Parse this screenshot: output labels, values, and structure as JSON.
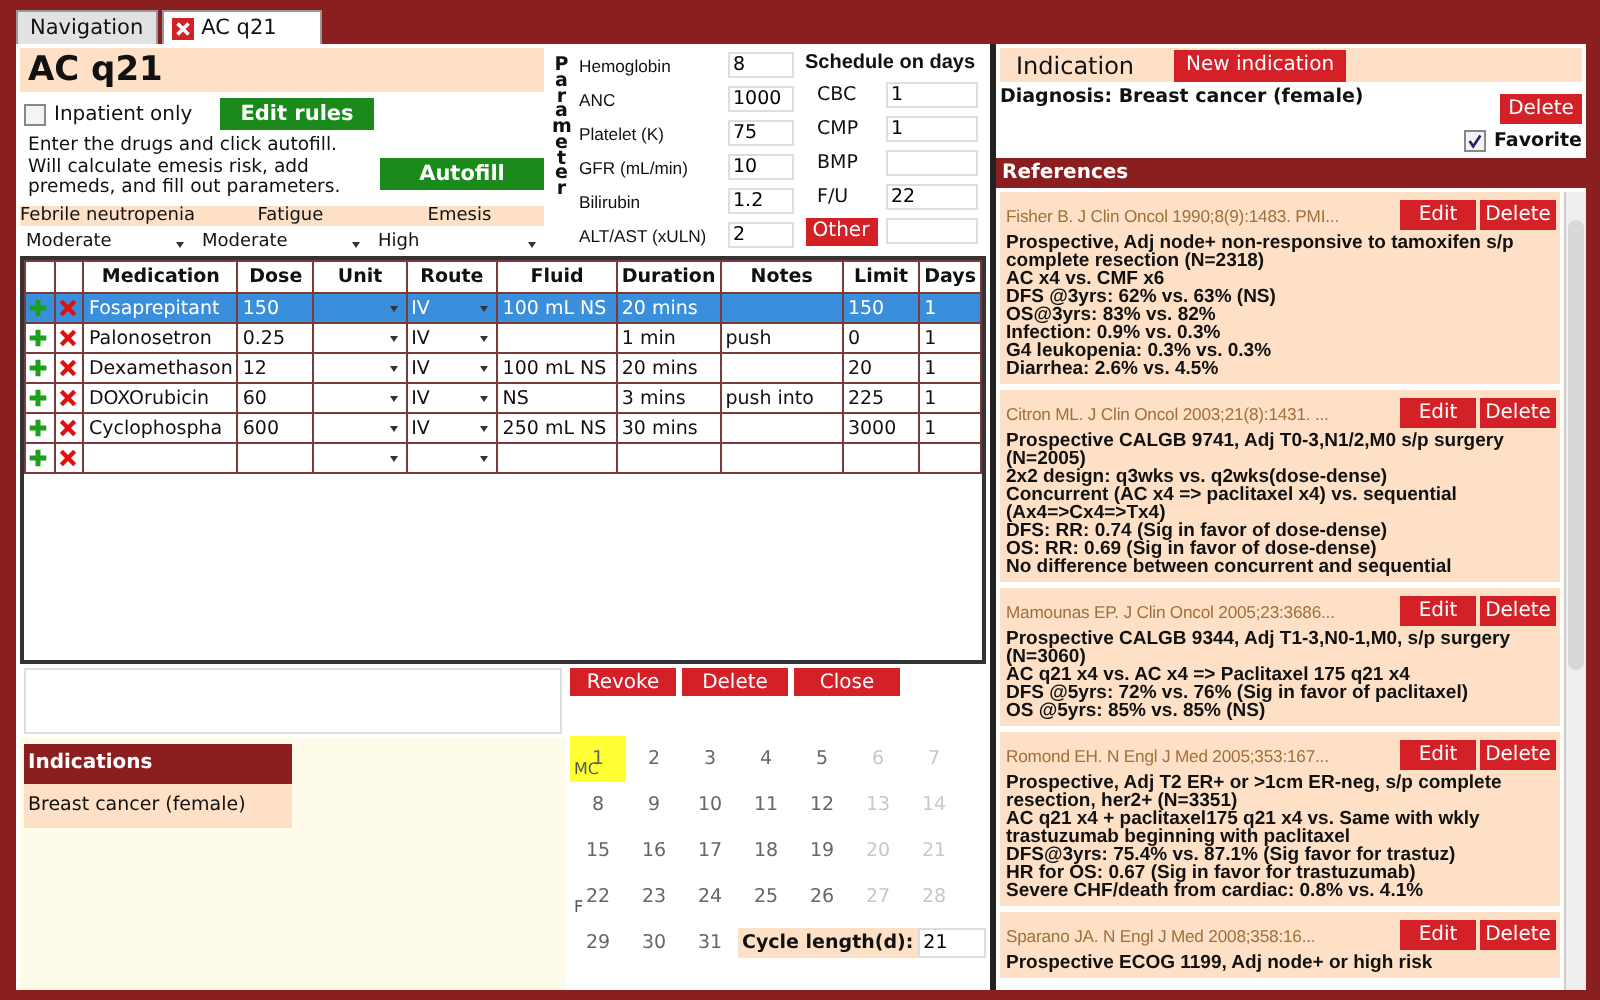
{
  "tabs": [
    {
      "label": "Navigation",
      "selected": false,
      "closable": false
    },
    {
      "label": "AC q21",
      "selected": true,
      "closable": true
    }
  ],
  "regimen": {
    "title": "AC q21",
    "inpatient_only": {
      "label": "Inpatient only",
      "checked": false
    },
    "edit_rules": "Edit rules",
    "instructions": "Enter the drugs and click autofill. Will calculate emesis risk, add premeds, and fill out parameters.",
    "autofill": "Autofill"
  },
  "toxicities": [
    {
      "label": "Febrile neutropenia",
      "value": "Moderate"
    },
    {
      "label": "Fatigue",
      "value": "Moderate"
    },
    {
      "label": "Emesis",
      "value": "High"
    }
  ],
  "parameters": {
    "title": "Parameter",
    "items": [
      {
        "label": "Hemoglobin",
        "value": "8"
      },
      {
        "label": "ANC",
        "value": "1000"
      },
      {
        "label": "Platelet (K)",
        "value": "75"
      },
      {
        "label": "GFR (mL/min)",
        "value": "10"
      },
      {
        "label": "Bilirubin",
        "value": "1.2"
      },
      {
        "label": "ALT/AST (xULN)",
        "value": "2"
      }
    ]
  },
  "schedule": {
    "title": "Schedule on days",
    "items": [
      {
        "kind": "label",
        "label": "CBC",
        "value": "1"
      },
      {
        "kind": "label",
        "label": "CMP",
        "value": "1"
      },
      {
        "kind": "label",
        "label": "BMP"
      },
      {
        "kind": "label",
        "label": "F/U",
        "value": "22"
      },
      {
        "kind": "button",
        "label": "Other"
      }
    ]
  },
  "table": {
    "columns": [
      "Medication",
      "Dose",
      "Unit",
      "Route",
      "Fluid",
      "Duration",
      "Notes",
      "Limit",
      "Days"
    ],
    "rows": [
      {
        "selected": true,
        "medication": "Fosaprepitant",
        "dose": "150",
        "route": "IV",
        "fluid": "100 mL NS",
        "duration": "20 mins",
        "limit": "150",
        "days": "1"
      },
      {
        "selected": false,
        "medication": "Palonosetron",
        "dose": "0.25",
        "route": "IV",
        "duration": "1 min",
        "notes": "push",
        "limit": "0",
        "days": "1"
      },
      {
        "selected": false,
        "medication": "Dexamethason",
        "dose": "12",
        "route": "IV",
        "fluid": "100 mL NS",
        "duration": "20 mins",
        "limit": "20",
        "days": "1"
      },
      {
        "selected": false,
        "medication": "DOXOrubicin",
        "dose": "60",
        "route": "IV",
        "fluid": "NS",
        "duration": "3 mins",
        "notes": "push into",
        "limit": "225",
        "days": "1"
      },
      {
        "selected": false,
        "medication": "Cyclophospha",
        "dose": "600",
        "route": "IV",
        "fluid": "250 mL NS",
        "duration": "30 mins",
        "limit": "3000",
        "days": "1"
      },
      {
        "selected": false
      }
    ]
  },
  "actions": [
    "Revoke",
    "Delete",
    "Close"
  ],
  "indications_panel": {
    "title": "Indications",
    "items": [
      "Breast cancer (female)"
    ]
  },
  "calendar": {
    "days": [
      {
        "day": "1",
        "weekend": false,
        "highlighted": true,
        "marker": "MC"
      },
      {
        "day": "2",
        "weekend": false,
        "highlighted": false
      },
      {
        "day": "3",
        "weekend": false,
        "highlighted": false
      },
      {
        "day": "4",
        "weekend": false,
        "highlighted": false
      },
      {
        "day": "5",
        "weekend": false,
        "highlighted": false
      },
      {
        "day": "6",
        "weekend": true,
        "highlighted": false
      },
      {
        "day": "7",
        "weekend": true,
        "highlighted": false
      },
      {
        "day": "8",
        "weekend": false,
        "highlighted": false
      },
      {
        "day": "9",
        "weekend": false,
        "highlighted": false
      },
      {
        "day": "10",
        "weekend": false,
        "highlighted": false
      },
      {
        "day": "11",
        "weekend": false,
        "highlighted": false
      },
      {
        "day": "12",
        "weekend": false,
        "highlighted": false
      },
      {
        "day": "13",
        "weekend": true,
        "highlighted": false
      },
      {
        "day": "14",
        "weekend": true,
        "highlighted": false
      },
      {
        "day": "15",
        "weekend": false,
        "highlighted": false
      },
      {
        "day": "16",
        "weekend": false,
        "highlighted": false
      },
      {
        "day": "17",
        "weekend": false,
        "highlighted": false
      },
      {
        "day": "18",
        "weekend": false,
        "highlighted": false
      },
      {
        "day": "19",
        "weekend": false,
        "highlighted": false
      },
      {
        "day": "20",
        "weekend": true,
        "highlighted": false
      },
      {
        "day": "21",
        "weekend": true,
        "highlighted": false
      },
      {
        "day": "22",
        "weekend": false,
        "highlighted": false,
        "marker": "F"
      },
      {
        "day": "23",
        "weekend": false,
        "highlighted": false
      },
      {
        "day": "24",
        "weekend": false,
        "highlighted": false
      },
      {
        "day": "25",
        "weekend": false,
        "highlighted": false
      },
      {
        "day": "26",
        "weekend": false,
        "highlighted": false
      },
      {
        "day": "27",
        "weekend": true,
        "highlighted": false
      },
      {
        "day": "28",
        "weekend": true,
        "highlighted": false
      },
      {
        "day": "29",
        "weekend": false,
        "highlighted": false
      },
      {
        "day": "30",
        "weekend": false,
        "highlighted": false
      },
      {
        "day": "31",
        "weekend": false,
        "highlighted": false
      }
    ],
    "cycle_length": {
      "label": "Cycle length(d):",
      "value": "21"
    }
  },
  "indication": {
    "title": "Indication",
    "new_button": "New indication",
    "diagnosis": "Diagnosis: Breast cancer (female)",
    "delete_button": "Delete",
    "favorite": {
      "label": "Favorite",
      "checked": true
    }
  },
  "references": {
    "title": "References",
    "items": [
      {
        "citation": "Fisher B. J Clin Oncol 1990;8(9):1483. PMI...",
        "edit": "Edit",
        "delete": "Delete",
        "lines": [
          "Prospective, Adj node+ non-responsive to tamoxifen s/p complete resection (N=2318)",
          "AC x4 vs. CMF x6",
          "DFS @3yrs: 62% vs. 63% (NS)",
          "OS@3yrs: 83% vs. 82%",
          "Infection: 0.9% vs. 0.3%",
          "G4 leukopenia: 0.3% vs. 0.3%",
          "Diarrhea: 2.6% vs. 4.5%"
        ]
      },
      {
        "citation": "Citron ML. J Clin Oncol 2003;21(8):1431. ...",
        "edit": "Edit",
        "delete": "Delete",
        "lines": [
          "Prospective CALGB 9741, Adj T0-3,N1/2,M0 s/p surgery (N=2005)",
          "2x2 design: q3wks vs. q2wks(dose-dense)",
          "Concurrent (AC x4 => paclitaxel x4) vs. sequential (Ax4=>Cx4=>Tx4)",
          "DFS: RR: 0.74 (Sig in favor of dose-dense)",
          "OS: RR: 0.69 (Sig in favor of dose-dense)",
          "No difference between concurrent and sequential"
        ]
      },
      {
        "citation": "Mamounas EP. J Clin Oncol 2005;23:3686...",
        "edit": "Edit",
        "delete": "Delete",
        "lines": [
          "Prospective CALGB 9344, Adj T1-3,N0-1,M0, s/p surgery (N=3060)",
          "AC q21 x4 vs. AC x4 => Paclitaxel 175 q21 x4",
          "DFS @5yrs: 72% vs. 76% (Sig in favor of paclitaxel)",
          "OS @5yrs: 85% vs. 85% (NS)"
        ]
      },
      {
        "citation": "Romond EH. N Engl J Med 2005;353:167...",
        "edit": "Edit",
        "delete": "Delete",
        "lines": [
          "Prospective, Adj T2 ER+ or >1cm ER-neg, s/p complete resection, her2+ (N=3351)",
          "AC q21 x4 + paclitaxel175 q21 x4 vs. Same with wkly trastuzumab beginning with paclitaxel",
          "DFS@3yrs: 75.4% vs. 87.1% (Sig favor for trastuz)",
          "HR for OS: 0.67 (Sig in favor for trastuzumab)",
          "Severe CHF/death from cardiac: 0.8% vs. 4.1%"
        ]
      },
      {
        "citation": "Sparano JA. N Engl J Med 2008;358:16...",
        "edit": "Edit",
        "delete": "Delete",
        "lines": [
          "Prospective ECOG 1199, Adj node+ or high risk"
        ]
      }
    ]
  }
}
